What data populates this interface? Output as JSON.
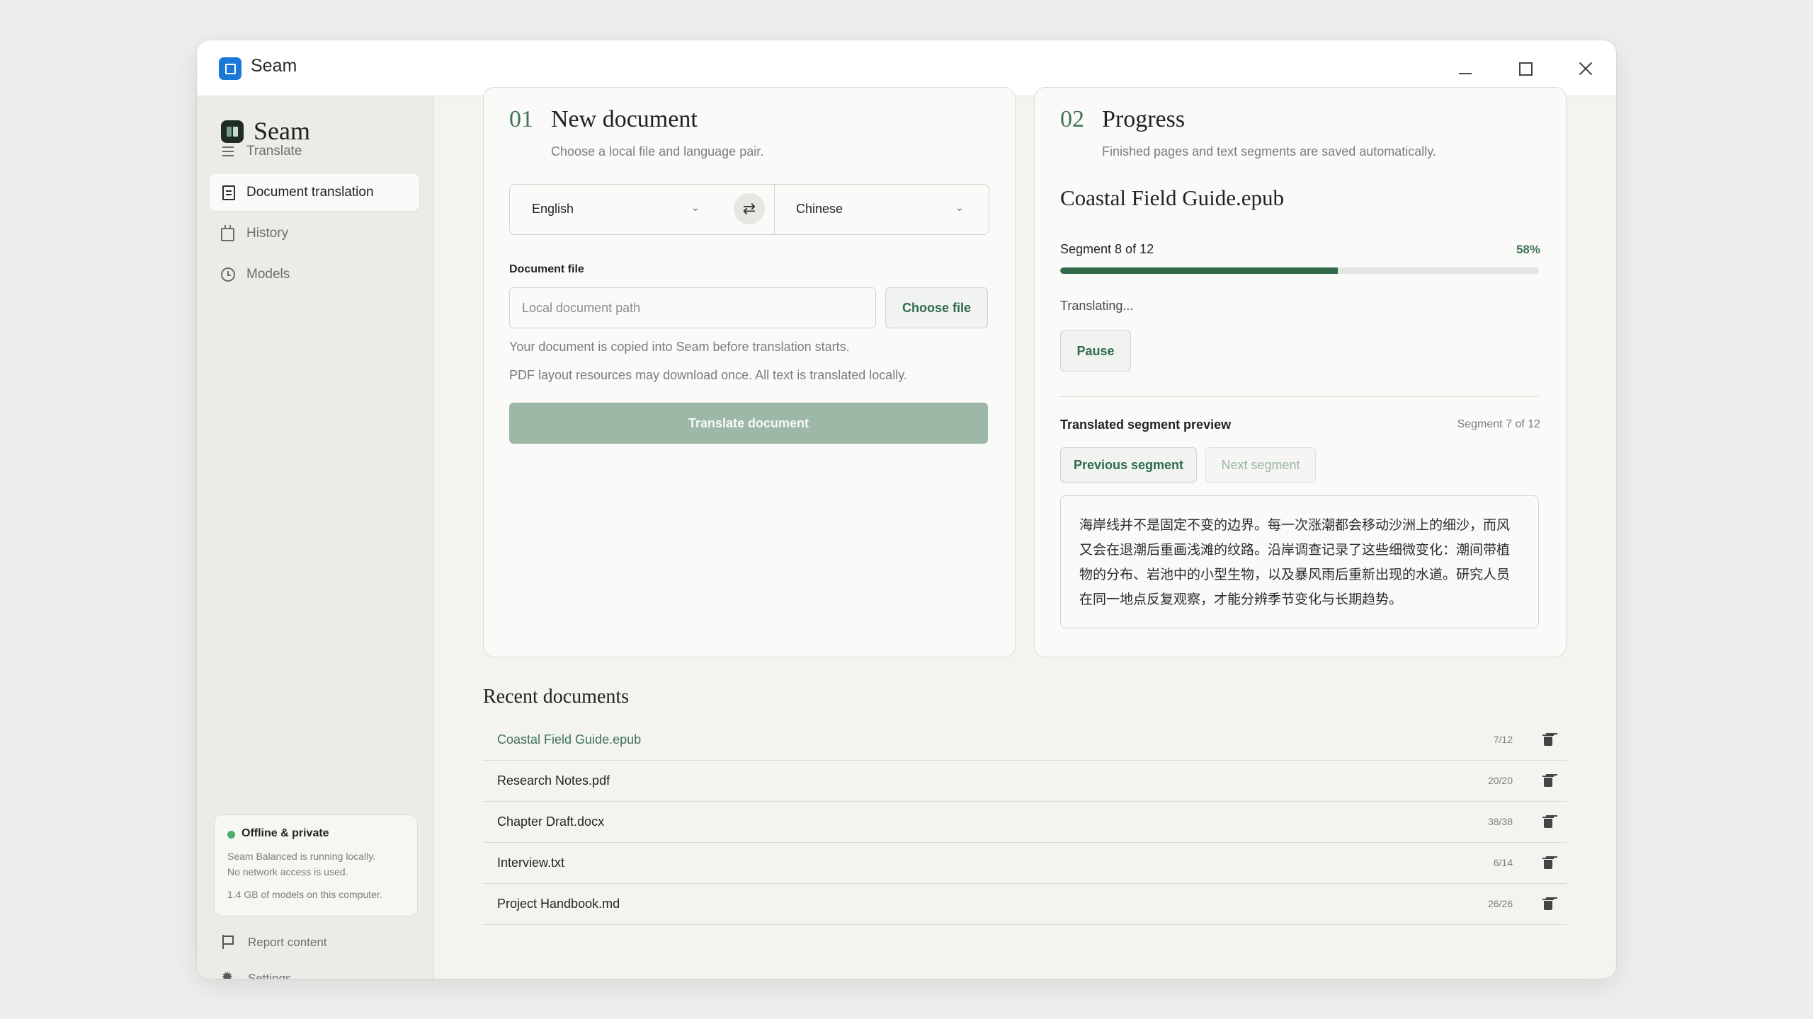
{
  "window": {
    "title": "Seam"
  },
  "sidebar": {
    "brand": "Seam",
    "items": [
      {
        "label": "Translate",
        "icon": "lines-icon"
      },
      {
        "label": "Document translation",
        "icon": "document-icon",
        "active": true
      },
      {
        "label": "History",
        "icon": "calendar-icon"
      },
      {
        "label": "Models",
        "icon": "clock-icon"
      }
    ],
    "status": {
      "title": "Offline & private",
      "line1": "Seam Balanced is running locally.",
      "line2": "No network access is used.",
      "line3": "1.4 GB of models on this computer."
    },
    "report": "Report content",
    "settings": "Settings"
  },
  "new_doc": {
    "num": "01",
    "title": "New document",
    "subtitle": "Choose a local file and language pair.",
    "source_lang": "English",
    "target_lang": "Chinese",
    "swap_glyph": "⇄",
    "file_label": "Document file",
    "path_placeholder": "Local document path",
    "choose_file": "Choose file",
    "hint1": "Your document is copied into Seam before translation starts.",
    "hint2": "PDF layout resources may download once. All text is translated locally.",
    "translate_button": "Translate document"
  },
  "progress": {
    "num": "02",
    "title": "Progress",
    "subtitle": "Finished pages and text segments are saved automatically.",
    "file_name": "Coastal Field Guide.epub",
    "segment_label": "Segment 8 of 12",
    "percent_label": "58%",
    "percent": 58,
    "status": "Translating...",
    "pause": "Pause",
    "preview_label": "Translated segment preview",
    "preview_segment": "Segment 7 of 12",
    "prev_button": "Previous segment",
    "next_button": "Next segment",
    "preview_text": "海岸线并不是固定不变的边界。每一次涨潮都会移动沙洲上的细沙，而风又会在退潮后重画浅滩的纹路。沿岸调查记录了这些细微变化：潮间带植物的分布、岩池中的小型生物，以及暴风雨后重新出现的水道。研究人员在同一地点反复观察，才能分辨季节变化与长期趋势。"
  },
  "recent": {
    "title": "Recent documents",
    "rows": [
      {
        "name": "Coastal Field Guide.epub",
        "count": "7/12"
      },
      {
        "name": "Research Notes.pdf",
        "count": "20/20"
      },
      {
        "name": "Chapter Draft.docx",
        "count": "38/38"
      },
      {
        "name": "Interview.txt",
        "count": "6/14"
      },
      {
        "name": "Project Handbook.md",
        "count": "26/26"
      }
    ]
  },
  "colors": {
    "accent": "#3f7356",
    "progress_fill": "#346a4c",
    "primary_disabled": "#9eb8a8",
    "status_dot": "#4caf68"
  }
}
